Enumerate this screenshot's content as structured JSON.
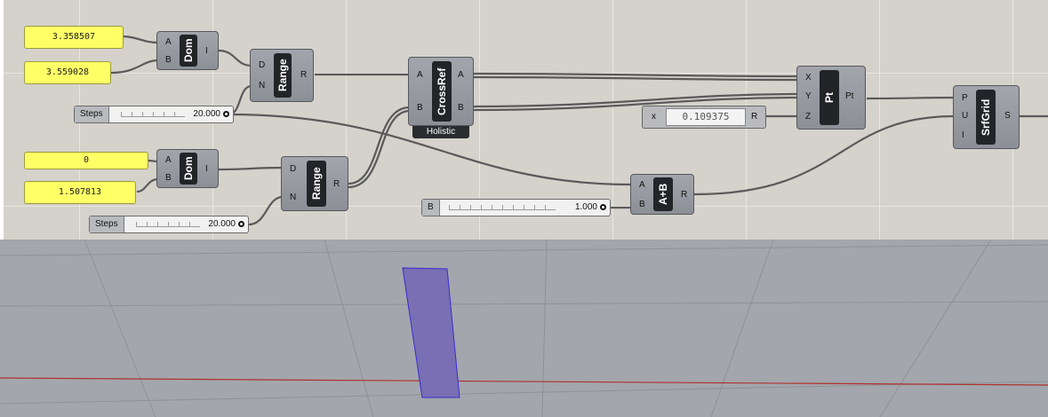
{
  "canvas": {
    "panels": [
      {
        "id": "p1",
        "value": "3.358507"
      },
      {
        "id": "p2",
        "value": "3.559028"
      },
      {
        "id": "p3",
        "value": "0"
      },
      {
        "id": "p4",
        "value": "1.507813"
      }
    ],
    "components": {
      "dom1": {
        "label": "Dom",
        "inputs": [
          "A",
          "B"
        ],
        "outputs": [
          "I"
        ]
      },
      "dom2": {
        "label": "Dom",
        "inputs": [
          "A",
          "B"
        ],
        "outputs": [
          "I"
        ]
      },
      "range1": {
        "label": "Range",
        "inputs": [
          "D",
          "N"
        ],
        "outputs": [
          "R"
        ]
      },
      "range2": {
        "label": "Range",
        "inputs": [
          "D",
          "N"
        ],
        "outputs": [
          "R"
        ]
      },
      "crossref": {
        "label": "CrossRef",
        "inputs": [
          "A",
          "B"
        ],
        "outputs": [
          "A",
          "B"
        ],
        "caption": "Holistic"
      },
      "pt": {
        "label": "Pt",
        "inputs": [
          "X",
          "Y",
          "Z"
        ],
        "outputs": [
          "Pt"
        ]
      },
      "add": {
        "label": "A+B",
        "inputs": [
          "A",
          "B"
        ],
        "outputs": [
          "R"
        ]
      },
      "srfgrid": {
        "label": "SrfGrid",
        "inputs": [
          "P",
          "U",
          "I"
        ],
        "outputs": [
          "S"
        ]
      }
    },
    "sliders": {
      "steps1": {
        "label": "Steps",
        "value": "20.000"
      },
      "steps2": {
        "label": "Steps",
        "value": "20.000"
      },
      "b": {
        "label": "B",
        "value": "1.000"
      }
    },
    "numberbox": {
      "label": "x",
      "value": "0.109375",
      "output": "R"
    }
  },
  "colors": {
    "canvas_bg": "#d5d2cb",
    "panel_yellow": "#ffff66",
    "component_body": "#9a9da3",
    "wire": "#5a5a5a",
    "viewport_bg": "#a3a6ac",
    "surface_fill": "#7a6fb4",
    "surface_edge": "#3a2ad0",
    "x_axis": "#b03030"
  }
}
